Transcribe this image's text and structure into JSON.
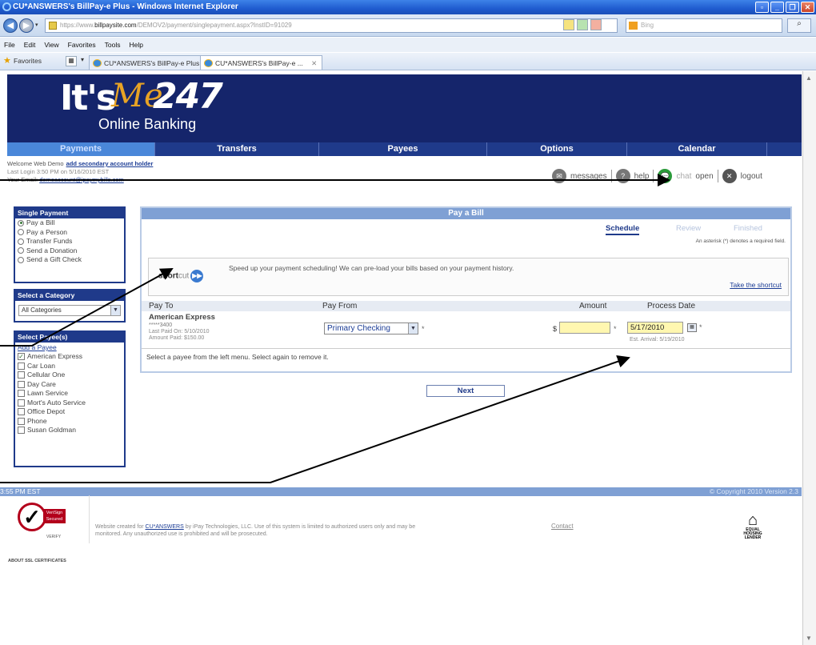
{
  "browser": {
    "title": "CU*ANSWERS's BillPay-e Plus - Windows Internet Explorer",
    "url_prefix": "https://www.",
    "url_domain": "billpaysite.com",
    "url_path": "/DEMOV2/payment/singlepayment.aspx?InstID=91029",
    "search_placeholder": "Bing",
    "menu": [
      "File",
      "Edit",
      "View",
      "Favorites",
      "Tools",
      "Help"
    ],
    "favorites_label": "Favorites",
    "tabs": [
      {
        "label": "CU*ANSWERS's BillPay-e Plus"
      },
      {
        "label": "CU*ANSWERS's BillPay-e ..."
      }
    ]
  },
  "site": {
    "logo_its": "It's",
    "logo_me": "Me",
    "logo_247": "247",
    "logo_sub": "Online Banking",
    "nav": [
      "Payments",
      "Transfers",
      "Payees",
      "Options",
      "Calendar"
    ],
    "welcome": "Welcome Web Demo",
    "add_secondary": "add secondary account holder",
    "last_login": "Last Login 3:50 PM on 5/16/2010 EST",
    "email_label": "Your Email:",
    "email": "demoaccount@ipaymybills.com",
    "quicklinks": {
      "messages": "messages",
      "help": "help",
      "chat": "chat",
      "chat_status": "open",
      "logout": "logout"
    }
  },
  "sidebar": {
    "single_payment": {
      "header": "Single Payment",
      "options": [
        {
          "label": "Pay a Bill",
          "selected": true
        },
        {
          "label": "Pay a Person",
          "selected": false
        },
        {
          "label": "Transfer Funds",
          "selected": false
        },
        {
          "label": "Send a Donation",
          "selected": false
        },
        {
          "label": "Send a Gift Check",
          "selected": false
        }
      ]
    },
    "category": {
      "header": "Select a Category",
      "selected": "All Categories"
    },
    "payees": {
      "header": "Select Payee(s)",
      "add_link": "Add a Payee",
      "items": [
        {
          "label": "American Express",
          "checked": true
        },
        {
          "label": "Car Loan",
          "checked": false
        },
        {
          "label": "Cellular One",
          "checked": false
        },
        {
          "label": "Day Care",
          "checked": false
        },
        {
          "label": "Lawn Service",
          "checked": false
        },
        {
          "label": "Mort's Auto Service",
          "checked": false
        },
        {
          "label": "Office Depot",
          "checked": false
        },
        {
          "label": "Phone",
          "checked": false
        },
        {
          "label": "Susan Goldman",
          "checked": false
        }
      ]
    }
  },
  "main": {
    "panel_title": "Pay a Bill",
    "steps": [
      "Schedule",
      "Review",
      "Finished"
    ],
    "required_note": "An asterisk (*) denotes a required field.",
    "shortcut": {
      "logo_short": "short",
      "logo_cut": "cut",
      "message": "Speed up your payment scheduling! We can pre-load your bills based on your payment history.",
      "link": "Take the shortcut"
    },
    "columns": [
      "Pay To",
      "Pay From",
      "Amount",
      "Process Date"
    ],
    "payment": {
      "payee": "American Express",
      "account": "*****3400",
      "last_paid": "Last Paid On: 5/10/2010",
      "amount_paid": "Amount Paid: $150.00",
      "pay_from": "Primary Checking",
      "currency": "$",
      "amount": "",
      "process_date": "5/17/2010",
      "est_arrival": "Est. Arrival: 5/19/2010"
    },
    "hint": "Select a payee from the left menu. Select again to remove it.",
    "next": "Next"
  },
  "footer": {
    "time": "3:55 PM EST",
    "copyright": "© Copyright 2010 Version 2.3",
    "verisign_badge": "VeriSign Secured",
    "verisign_verify": "VERIFY",
    "ssl": "ABOUT SSL CERTIFICATES",
    "disclaimer_pre": "Website created for ",
    "disclaimer_link": "CU*ANSWERS",
    "disclaimer_post": " by iPay Technologies, LLC. Use of this system is limited to authorized users only and may be monitored. Any unauthorized use is prohibited and will be prosecuted.",
    "contact": "Contact",
    "ehl": "EQUAL HOUSING LENDER"
  }
}
